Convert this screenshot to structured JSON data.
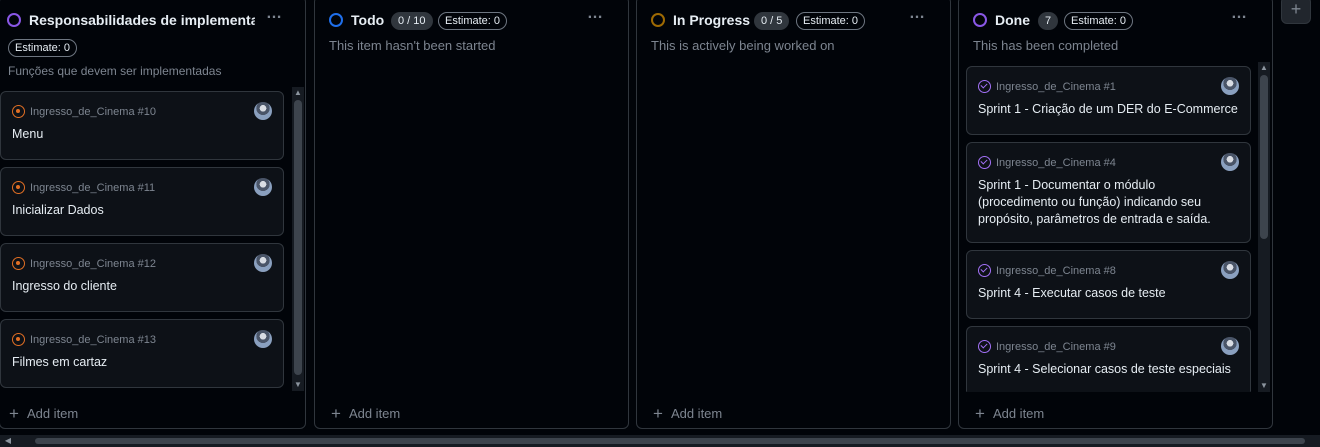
{
  "columns": [
    {
      "title": "Responsabilidades de implementação",
      "estimate": "Estimate: 0",
      "description": "Funções que devem ser implementadas",
      "status_color": "#8957e5",
      "cards": [
        {
          "ref": "Ingresso_de_Cinema #10",
          "title": "Menu"
        },
        {
          "ref": "Ingresso_de_Cinema #11",
          "title": "Inicializar Dados"
        },
        {
          "ref": "Ingresso_de_Cinema #12",
          "title": "Ingresso do cliente"
        },
        {
          "ref": "Ingresso_de_Cinema #13",
          "title": "Filmes em cartaz"
        }
      ],
      "add_item": "Add item"
    },
    {
      "title": "Todo",
      "count": "0 / 10",
      "estimate": "Estimate: 0",
      "description": "This item hasn't been started",
      "status_color": "#1f6feb",
      "cards": [],
      "add_item": "Add item"
    },
    {
      "title": "In Progress",
      "count": "0 / 5",
      "estimate": "Estimate: 0",
      "description": "This is actively being worked on",
      "status_color": "#9e6a03",
      "cards": [],
      "add_item": "Add item"
    },
    {
      "title": "Done",
      "count": "7",
      "estimate": "Estimate: 0",
      "description": "This has been completed",
      "status_color": "#8957e5",
      "cards": [
        {
          "ref": "Ingresso_de_Cinema #1",
          "title": "Sprint 1 - Criação de um DER do E-Commerce"
        },
        {
          "ref": "Ingresso_de_Cinema #4",
          "title": "Sprint 1 - Documentar o módulo (procedimento ou função) indicando seu propósito, parâmetros de entrada e saída."
        },
        {
          "ref": "Ingresso_de_Cinema #8",
          "title": "Sprint 4 - Executar casos de teste"
        },
        {
          "ref": "Ingresso_de_Cinema #9",
          "title": "Sprint 4 - Selecionar casos de teste especiais"
        }
      ],
      "add_item": "Add item"
    }
  ],
  "new_column_label": "+",
  "colors": {
    "background": "#010409",
    "card": "#0d1117",
    "border": "#30363d",
    "open_issue": "#e16f24",
    "done_issue": "#a371f7"
  }
}
